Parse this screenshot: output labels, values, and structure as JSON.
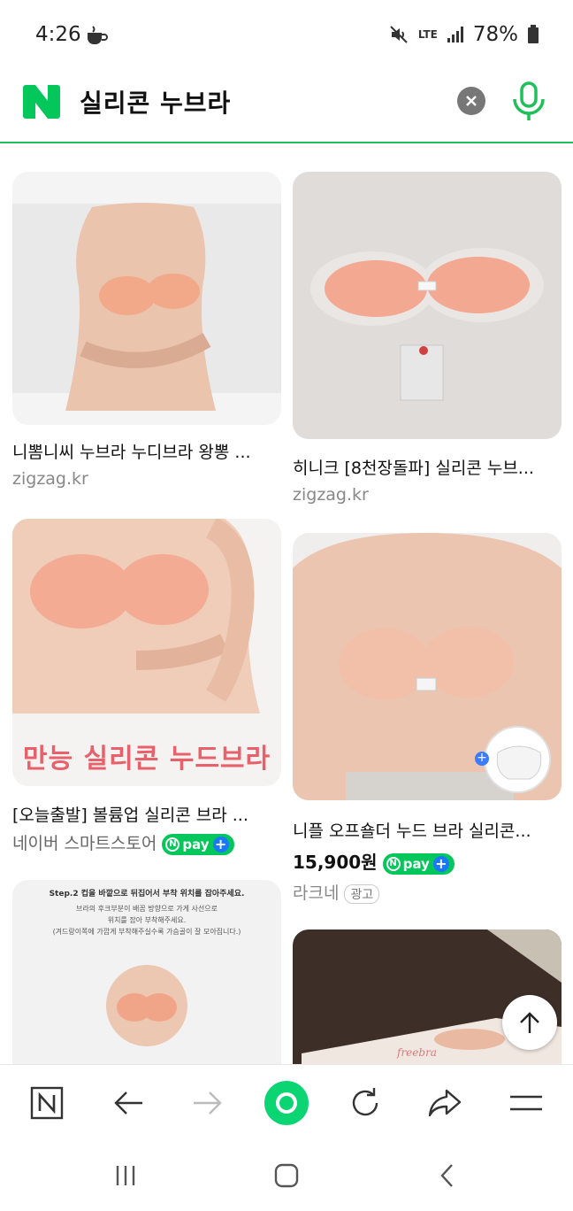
{
  "status_bar": {
    "time": "4:26",
    "network": "LTE",
    "battery": "78%"
  },
  "search": {
    "logo": "N",
    "query": "실리콘 누브라",
    "clear_icon": "clear-icon",
    "mic_icon": "mic-icon"
  },
  "results": [
    {
      "title": "니뽐니씨 누브라 누디브라 왕뽕 ...",
      "source": "zigzag.kr"
    },
    {
      "title": "히니크 [8천장돌파] 실리콘 누브...",
      "source": "zigzag.kr"
    },
    {
      "title": "[오늘출발] 볼륨업 실리콘 브라 ...",
      "source": "네이버 스마트스토어",
      "npay": "pay",
      "image_caption": "만능 실리콘 누드브라"
    },
    {
      "title": "니플 오프숄더 누드 브라 실리콘...",
      "price": "15,900원",
      "npay": "pay",
      "source": "라크네",
      "ad_label": "광고"
    },
    {
      "image_text": [
        "Step.2 컵을 바깥으로 뒤집어서 부착 위치를 잡아주세요.",
        "브라의 후크부분이 배꼽 방향으로 가게 사선으로",
        "위치를 잡아 부착해주세요.",
        "(겨드랑이쪽에 가깝게 부착해주실수록 가슴골이 잘 모아집니다.)"
      ]
    },
    {
      "image_text": "freebra"
    }
  ],
  "toolbar": {
    "items": [
      "home-n-icon",
      "back-icon",
      "forward-icon",
      "green-dot-icon",
      "refresh-icon",
      "share-icon",
      "menu-icon"
    ]
  },
  "colors": {
    "naver_green": "#03c75a",
    "header_border": "#20c35b",
    "promo_pink": "#e8616a"
  }
}
